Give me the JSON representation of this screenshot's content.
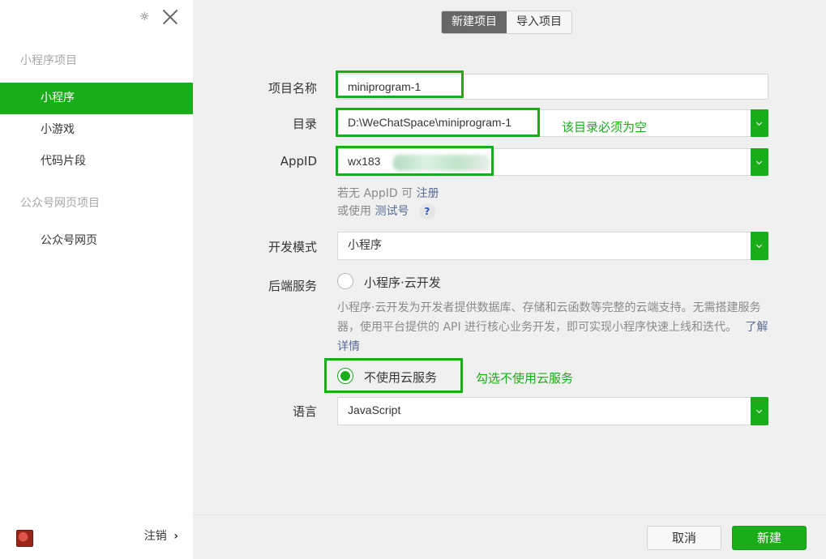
{
  "sidebar": {
    "section_miniprogram": "小程序项目",
    "items": [
      {
        "label": "小程序"
      },
      {
        "label": "小游戏"
      },
      {
        "label": "代码片段"
      }
    ],
    "section_official": "公众号网页项目",
    "official_items": [
      {
        "label": "公众号网页"
      }
    ],
    "logout_label": "注销",
    "logout_arrow": "›"
  },
  "tabs": {
    "new_project": "新建项目",
    "import_project": "导入项目"
  },
  "form": {
    "name_label": "项目名称",
    "name_value": "miniprogram-1",
    "dir_label": "目录",
    "dir_value": "D:\\WeChatSpace\\miniprogram-1",
    "dir_annotation": "该目录必须为空",
    "appid_label": "AppID",
    "appid_value": "wx183",
    "appid_hint_prefix": "若无 AppID 可",
    "appid_hint_link": "注册",
    "appid_test_prefix": "或使用",
    "appid_test_link": "测试号",
    "help_icon": "?",
    "mode_label": "开发模式",
    "mode_value": "小程序",
    "backend_label": "后端服务",
    "cloud_option": "小程序·云开发",
    "cloud_desc": "小程序·云开发为开发者提供数据库、存储和云函数等完整的云端支持。无需搭建服务器，使用平台提供的 API 进行核心业务开发，即可实现小程序快速上线和迭代。",
    "cloud_more_link": "了解详情",
    "no_cloud_option": "不使用云服务",
    "no_cloud_annotation": "勾选不使用云服务",
    "lang_label": "语言",
    "lang_value": "JavaScript"
  },
  "footer": {
    "cancel_label": "取消",
    "create_label": "新建"
  },
  "colors": {
    "accent": "#1aad19",
    "link": "#576b95"
  }
}
